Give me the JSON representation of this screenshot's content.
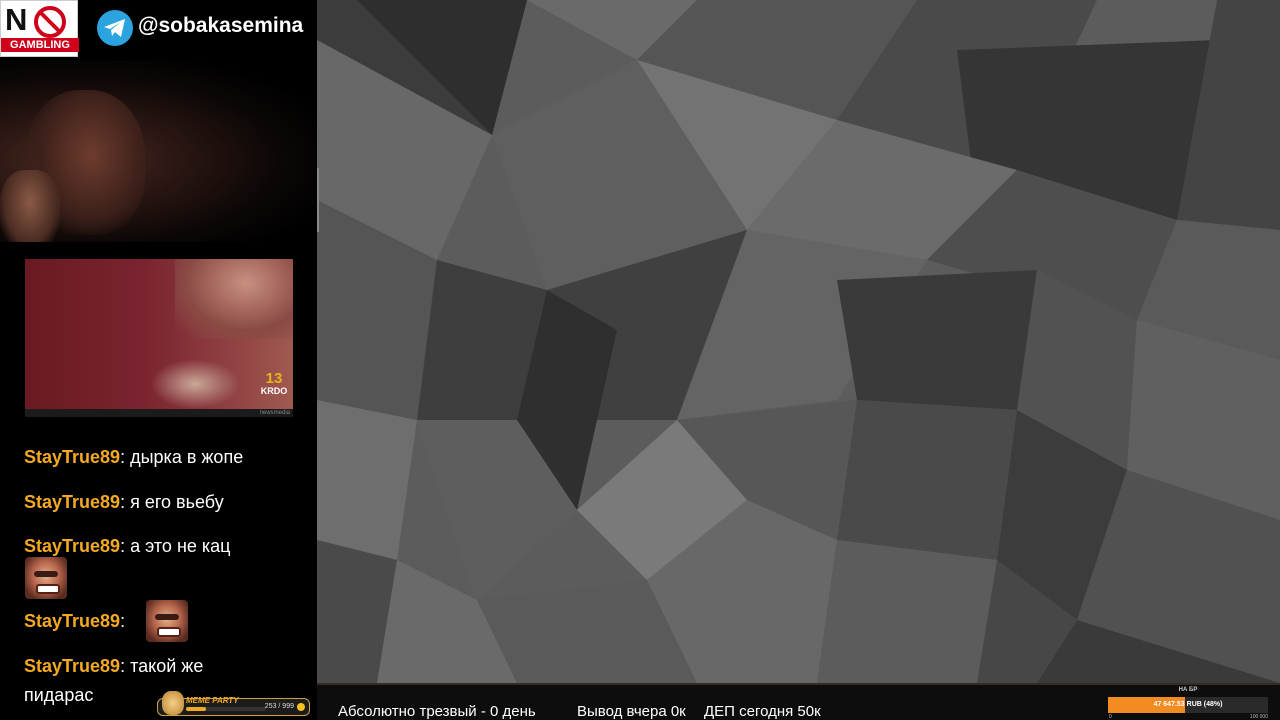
{
  "overlay": {
    "no_gambling_prefix": "N",
    "no_gambling_label": "GAMBLING",
    "telegram_handle": "@sobakasemina",
    "clip_logo_number": "13",
    "clip_logo_text": "KRDO",
    "clip_footer": "newsmedia"
  },
  "chat": {
    "messages": [
      {
        "user": "StayTrue89",
        "colon": ":",
        "text": "дырка в жопе"
      },
      {
        "user": "StayTrue89",
        "colon": ":",
        "text": "я его вьебу"
      },
      {
        "user": "StayTrue89",
        "colon": ":",
        "text": "а это не кац"
      },
      {
        "user": "StayTrue89",
        "colon": ":",
        "text": ""
      },
      {
        "user": "StayTrue89",
        "colon": ":",
        "text": "такой же"
      },
      {
        "user": "",
        "colon": "",
        "text": "пидарас"
      }
    ]
  },
  "meme_party": {
    "title": "MEME PARTY",
    "count": "253 / 999",
    "fraction": 0.253
  },
  "bottom_bar": {
    "sober": "Абсолютно трезвый - 0 день",
    "withdraw": "Вывод вчера 0к",
    "deposit": "ДЕП сегодня 50к"
  },
  "goal_widget": {
    "label": "НА БР",
    "amount": "47 647.53 RUB (48%)",
    "percent": 0.48,
    "min": "0",
    "max": "100 000",
    "fill_color": "#f28b22"
  },
  "colors": {
    "username": "#f4a922",
    "telegram": "#2aa3df"
  }
}
